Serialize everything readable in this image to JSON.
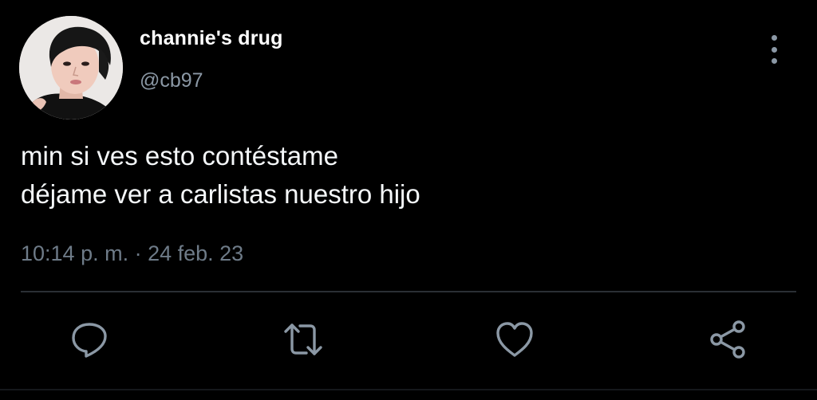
{
  "author": {
    "display_name": "channie's drug",
    "handle": "@cb97"
  },
  "tweet": {
    "lines": [
      "min si ves esto contéstame",
      "déjame ver a carlistas nuestro hijo"
    ],
    "timestamp": "10:14 p. m. · 24 feb. 23"
  },
  "actions": [
    {
      "icon": "reply-icon"
    },
    {
      "icon": "retweet-icon"
    },
    {
      "icon": "like-icon"
    },
    {
      "icon": "share-icon"
    }
  ],
  "colors": {
    "background": "#000000",
    "text": "#f5f8fa",
    "secondary_text": "#8b98a5",
    "icon": "#8b98a5",
    "divider": "#2a2f34"
  }
}
